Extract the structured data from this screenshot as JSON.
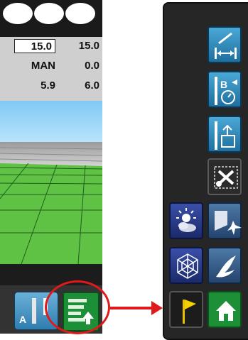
{
  "readout": {
    "row1": {
      "left": "15.0",
      "right": "15.0"
    },
    "row2": {
      "left": "MAN",
      "right": "0.0"
    },
    "row3": {
      "left": "5.9",
      "right": "6.0"
    }
  },
  "bottom_bar": {
    "a_button_letter": "A"
  },
  "colors": {
    "callout": "#e01a1a",
    "sky": "#7fc9f5",
    "field_green": "#5fc245",
    "highlight_green": "#1d8f37"
  },
  "icons": {
    "panel": [
      "edit-width-icon",
      "ab-guidance-icon",
      "load-file-icon",
      "settings-tools-icon",
      "weather-icon",
      "fly-to-icon",
      "web-grid-icon",
      "bird-icon",
      "flag-icon",
      "home-icon"
    ],
    "bottom": [
      "ab-line-icon",
      "navigation-icon"
    ]
  }
}
